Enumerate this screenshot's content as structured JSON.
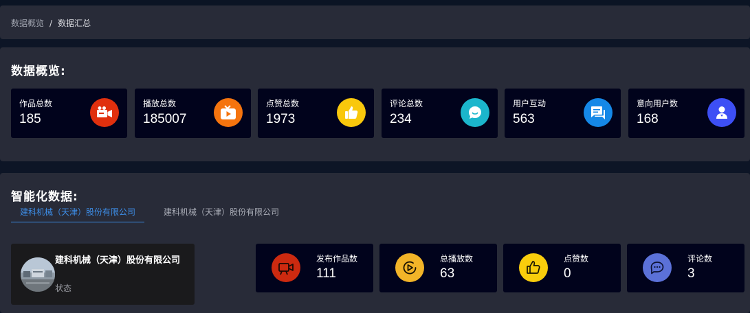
{
  "breadcrumb": {
    "parent": "数据概览",
    "separator": "/",
    "current": "数据汇总"
  },
  "overview": {
    "title": "数据概览:",
    "cards": [
      {
        "label": "作品总数",
        "value": "185",
        "icon": "video-camera-icon",
        "color": "#e0300e"
      },
      {
        "label": "播放总数",
        "value": "185007",
        "icon": "tv-play-icon",
        "color": "#f5740e"
      },
      {
        "label": "点赞总数",
        "value": "1973",
        "icon": "thumbs-up-icon",
        "color": "#f9c80c"
      },
      {
        "label": "评论总数",
        "value": "234",
        "icon": "comment-bubble-icon",
        "color": "#1bb6cc"
      },
      {
        "label": "用户互动",
        "value": "563",
        "icon": "chat-icon",
        "color": "#1588e7"
      },
      {
        "label": "意向用户数",
        "value": "168",
        "icon": "user-badge-icon",
        "color": "#3d4ff5"
      }
    ]
  },
  "smart": {
    "title": "智能化数据:",
    "tabs": [
      {
        "label": "建科机械（天津）股份有限公司",
        "active": true
      },
      {
        "label": "建科机械（天津）股份有限公司",
        "active": false
      }
    ],
    "company": {
      "name": "建科机械（天津）股份有限公司",
      "status": "状态"
    },
    "metrics": [
      {
        "label": "发布作品数",
        "value": "111",
        "icon": "video-camera-outline-icon",
        "color": "#cc2a10"
      },
      {
        "label": "总播放数",
        "value": "63",
        "icon": "play-circle-icon",
        "color": "#f2b428"
      },
      {
        "label": "点赞数",
        "value": "0",
        "icon": "thumbs-up-outline-icon",
        "color": "#f9cd0c"
      },
      {
        "label": "评论数",
        "value": "3",
        "icon": "message-dots-icon",
        "color": "#5b71d8"
      }
    ]
  }
}
